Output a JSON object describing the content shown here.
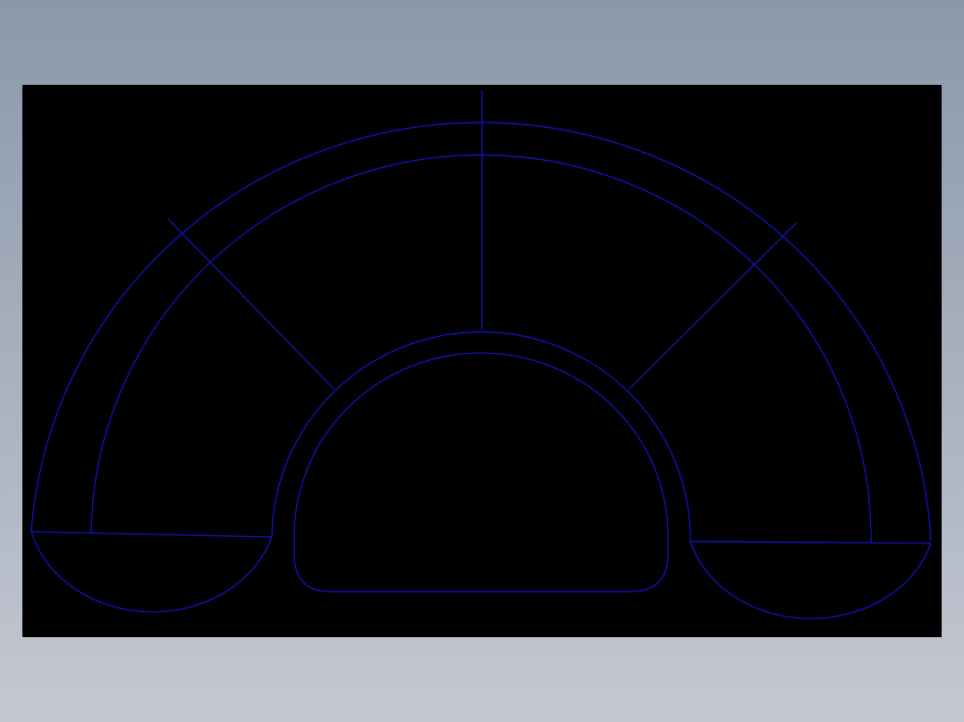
{
  "colors": {
    "canvas_background": "#000000",
    "stroke": "#1515d6",
    "window_gradient_top": "#8a98aa",
    "window_gradient_bottom": "#c4c8d2"
  },
  "drawing": {
    "view": "front",
    "description_elements": [
      "outer-arc",
      "inner-arc",
      "center-divider",
      "left-divider",
      "right-divider",
      "arch-outer",
      "arch-inner",
      "left-base-line",
      "left-lobe",
      "right-base-line",
      "right-lobe"
    ]
  }
}
